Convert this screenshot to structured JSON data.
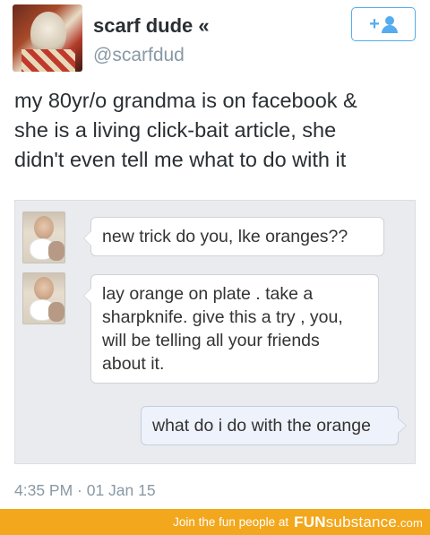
{
  "header": {
    "display_name": "scarf dude «",
    "handle": "@scarfdud",
    "follow_plus": "+"
  },
  "tweet": {
    "text_lines": [
      "my 80yr/o grandma is on facebook &",
      "she is a living click-bait article, she",
      "didn't even tell me what to do with it"
    ],
    "timestamp": "4:35 PM · 01 Jan 15"
  },
  "chat": {
    "messages": [
      {
        "from": "grandma",
        "lines": [
          "new trick do you, lke oranges??"
        ]
      },
      {
        "from": "grandma",
        "lines": [
          "lay orange on plate . take a",
          "sharpknife. give this a try , you,",
          "will be telling all your friends",
          "about it."
        ]
      },
      {
        "from": "me",
        "lines": [
          "what do i do with the orange"
        ]
      }
    ]
  },
  "footer": {
    "tagline": "Join the fun people at",
    "logo_fun": "FUN",
    "logo_substance": "substance",
    "logo_com": ".com"
  },
  "colors": {
    "accent": "#55acee",
    "banner": "#f2a71c",
    "muted": "#8899a6",
    "text": "#292f33"
  }
}
